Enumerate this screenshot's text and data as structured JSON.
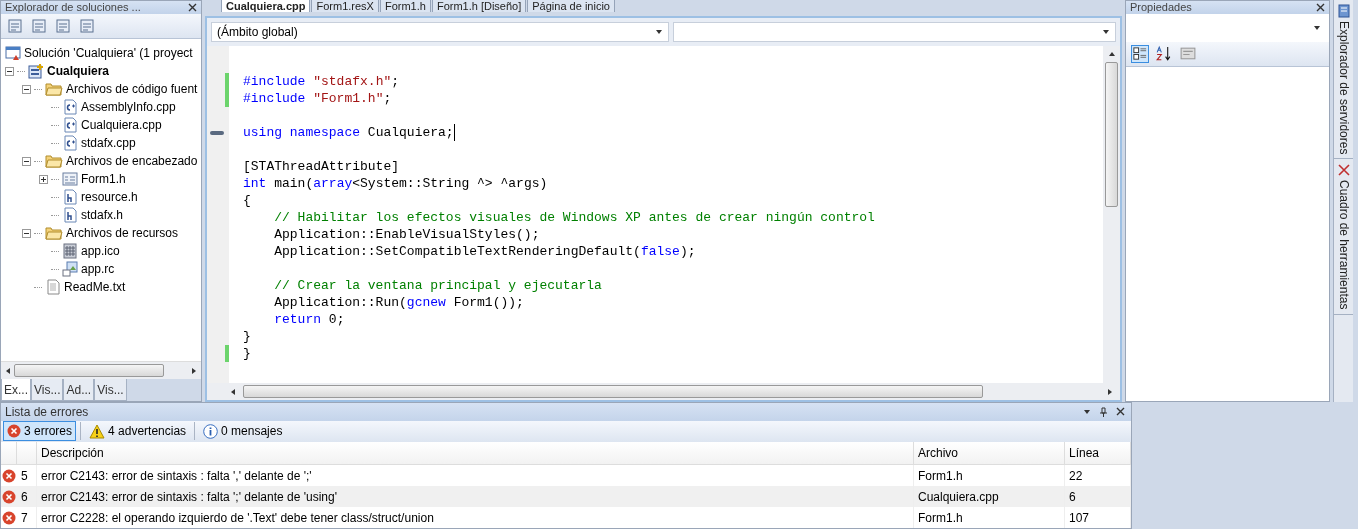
{
  "solution_explorer": {
    "title": "Explorador de soluciones ...",
    "tree": [
      {
        "label": "Solución 'Cualquiera'  (1 proyect",
        "kind": "solution",
        "children": [
          {
            "label": "Cualquiera",
            "kind": "project",
            "expanded": true,
            "children": [
              {
                "label": "Archivos de código fuent",
                "kind": "folder",
                "expanded": true,
                "children": [
                  {
                    "label": "AssemblyInfo.cpp",
                    "kind": "cpp"
                  },
                  {
                    "label": "Cualquiera.cpp",
                    "kind": "cpp"
                  },
                  {
                    "label": "stdafx.cpp",
                    "kind": "cpp"
                  }
                ]
              },
              {
                "label": "Archivos de encabezado",
                "kind": "folder",
                "expanded": true,
                "children": [
                  {
                    "label": "Form1.h",
                    "kind": "form",
                    "expanded": false
                  },
                  {
                    "label": "resource.h",
                    "kind": "header"
                  },
                  {
                    "label": "stdafx.h",
                    "kind": "header"
                  }
                ]
              },
              {
                "label": "Archivos de recursos",
                "kind": "folder",
                "expanded": true,
                "children": [
                  {
                    "label": "app.ico",
                    "kind": "ico"
                  },
                  {
                    "label": "app.rc",
                    "kind": "rc"
                  }
                ]
              },
              {
                "label": "ReadMe.txt",
                "kind": "txt"
              }
            ]
          }
        ]
      }
    ],
    "bottom_tabs": [
      {
        "label": "Ex...",
        "selected": true
      },
      {
        "label": "Vis...",
        "selected": false
      },
      {
        "label": "Ad...",
        "selected": false
      },
      {
        "label": "Vis...",
        "selected": false
      }
    ]
  },
  "editor": {
    "tabs": [
      {
        "label": "Cualquiera.cpp",
        "selected": true
      },
      {
        "label": "Form1.resX",
        "selected": false
      },
      {
        "label": "Form1.h",
        "selected": false
      },
      {
        "label": "Form1.h [Diseño]",
        "selected": false
      },
      {
        "label": "Página de inicio",
        "selected": false
      }
    ],
    "scope_dropdown": "(Ámbito global)",
    "lines": [
      {
        "kind": "blank"
      },
      {
        "changed": true,
        "tokens": [
          {
            "text": "#include ",
            "kind": "keyword"
          },
          {
            "text": "\"stdafx.h\"",
            "kind": "string"
          },
          {
            "text": ";",
            "kind": "plain"
          }
        ]
      },
      {
        "changed": true,
        "tokens": [
          {
            "text": "#include ",
            "kind": "keyword"
          },
          {
            "text": "\"Form1.h\"",
            "kind": "string"
          },
          {
            "text": ";",
            "kind": "plain"
          }
        ]
      },
      {
        "kind": "blank"
      },
      {
        "changed": false,
        "bookmark": true,
        "cursor": true,
        "tokens": [
          {
            "text": "using namespace ",
            "kind": "keyword"
          },
          {
            "text": "Cualquiera;",
            "kind": "plain"
          }
        ]
      },
      {
        "kind": "blank"
      },
      {
        "changed": false,
        "tokens": [
          {
            "text": "[STAThreadAttribute]",
            "kind": "plain"
          }
        ]
      },
      {
        "changed": false,
        "tokens": [
          {
            "text": "int ",
            "kind": "keyword"
          },
          {
            "text": "main(",
            "kind": "plain"
          },
          {
            "text": "array",
            "kind": "keyword"
          },
          {
            "text": "<System::String ^> ^args)",
            "kind": "plain"
          }
        ]
      },
      {
        "changed": false,
        "tokens": [
          {
            "text": "{",
            "kind": "plain"
          }
        ]
      },
      {
        "changed": false,
        "tokens": [
          {
            "text": "    // Habilitar los efectos visuales de Windows XP antes de crear ningún control",
            "kind": "comment"
          }
        ]
      },
      {
        "changed": false,
        "tokens": [
          {
            "text": "    Application::EnableVisualStyles();",
            "kind": "plain"
          }
        ]
      },
      {
        "changed": false,
        "tokens": [
          {
            "text": "    Application::SetCompatibleTextRenderingDefault(",
            "kind": "plain"
          },
          {
            "text": "false",
            "kind": "keyword"
          },
          {
            "text": ");",
            "kind": "plain"
          }
        ]
      },
      {
        "kind": "blank"
      },
      {
        "changed": false,
        "tokens": [
          {
            "text": "    // Crear la ventana principal y ejecutarla",
            "kind": "comment"
          }
        ]
      },
      {
        "changed": false,
        "tokens": [
          {
            "text": "    Application::Run(",
            "kind": "plain"
          },
          {
            "text": "gcnew ",
            "kind": "keyword"
          },
          {
            "text": "Form1());",
            "kind": "plain"
          }
        ]
      },
      {
        "changed": false,
        "tokens": [
          {
            "text": "    return ",
            "kind": "keyword"
          },
          {
            "text": "0;",
            "kind": "plain"
          }
        ]
      },
      {
        "changed": false,
        "tokens": [
          {
            "text": "}",
            "kind": "plain"
          }
        ]
      },
      {
        "changed": true,
        "tokens": [
          {
            "text": "}",
            "kind": "plain"
          }
        ]
      }
    ]
  },
  "properties": {
    "title": "Propiedades",
    "tools": [
      {
        "kind": "categorized",
        "selected": true
      },
      {
        "kind": "alphabetical",
        "selected": false
      },
      {
        "kind": "pages",
        "selected": false
      }
    ]
  },
  "side_tabs": [
    {
      "label": "Explorador de servidores",
      "kind": "server"
    },
    {
      "label": "Cuadro de herramientas",
      "kind": "toolbox"
    }
  ],
  "error_list": {
    "title": "Lista de errores",
    "filters": [
      {
        "label": "3 errores",
        "kind": "error",
        "selected": true
      },
      {
        "label": "4 advertencias",
        "kind": "warning",
        "selected": false
      },
      {
        "label": "0 mensajes",
        "kind": "info",
        "selected": false
      }
    ],
    "columns": {
      "description": "Descripción",
      "file": "Archivo",
      "line": "Línea"
    },
    "rows": [
      {
        "kind": "error",
        "number": "5",
        "description": "error C2143: error de sintaxis : falta ',' delante de ';'",
        "file": "Form1.h",
        "line": "22"
      },
      {
        "kind": "error",
        "number": "6",
        "description": "error C2143: error de sintaxis : falta ';' delante de 'using'",
        "file": "Cualquiera.cpp",
        "line": "6"
      },
      {
        "kind": "error",
        "number": "7",
        "description": "error C2228: el operando izquierdo de '.Text' debe tener class/struct/union",
        "file": "Form1.h",
        "line": "107"
      }
    ]
  }
}
